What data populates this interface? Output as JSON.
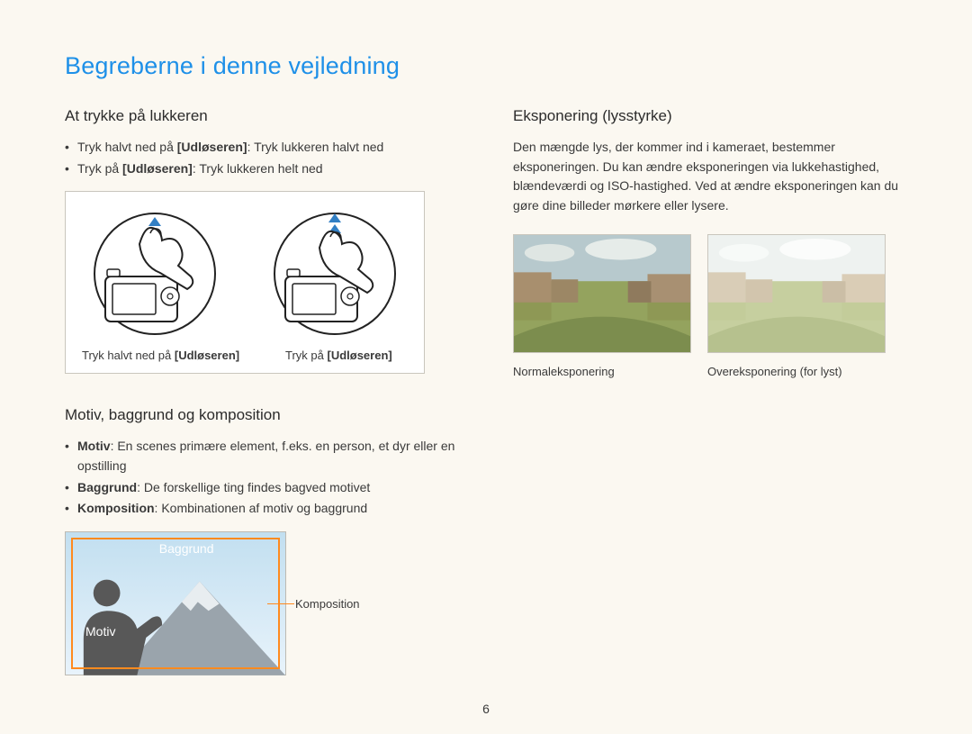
{
  "title": "Begreberne i denne vejledning",
  "page_number": "6",
  "left": {
    "shutter": {
      "heading": "At trykke på lukkeren",
      "bullets": [
        {
          "pre": "Tryk halvt ned på ",
          "bold": "[Udløseren]",
          "post": ": Tryk lukkeren halvt ned"
        },
        {
          "pre": "Tryk på ",
          "bold": "[Udløseren]",
          "post": ": Tryk lukkeren helt ned"
        }
      ],
      "cap1_pre": "Tryk halvt ned på ",
      "cap1_bold": "[Udløseren]",
      "cap2_pre": "Tryk på ",
      "cap2_bold": "[Udløseren]"
    },
    "comp": {
      "heading": "Motiv, baggrund og komposition",
      "bullets": [
        {
          "bold": "Motiv",
          "post": ": En scenes primære element, f.eks. en person, et dyr eller en opstilling"
        },
        {
          "bold": "Baggrund",
          "post": ": De forskellige ting findes bagved motivet"
        },
        {
          "bold": "Komposition",
          "post": ": Kombinationen af motiv og baggrund"
        }
      ],
      "label_bg": "Baggrund",
      "label_motiv": "Motiv",
      "label_komp": "Komposition"
    }
  },
  "right": {
    "expo": {
      "heading": "Eksponering (lysstyrke)",
      "paragraph": "Den mængde lys, der kommer ind i kameraet, bestemmer eksponeringen. Du kan ændre eksponeringen via lukkehastighed, blændeværdi og ISO-hastighed. Ved at ændre eksponeringen kan du gøre dine billeder mørkere eller lysere.",
      "img1_cap": "Normaleksponering",
      "img2_cap": "Overeksponering (for lyst)"
    }
  }
}
